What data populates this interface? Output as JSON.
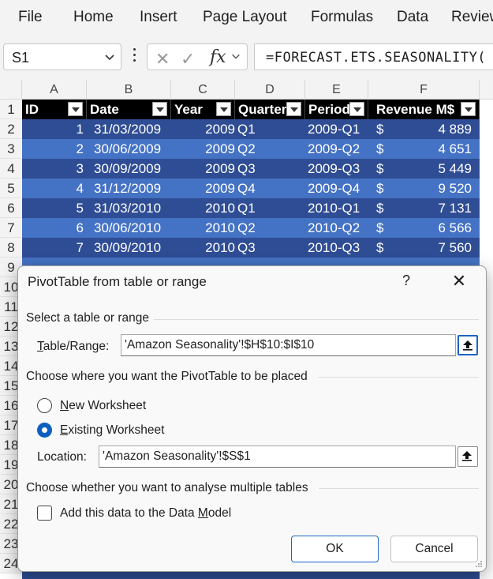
{
  "ribbon": {
    "tabs": [
      "File",
      "Home",
      "Insert",
      "Page Layout",
      "Formulas",
      "Data",
      "Review"
    ]
  },
  "formula_bar": {
    "name_box": "S1",
    "formula": "=FORECAST.ETS.SEASONALITY("
  },
  "sheet": {
    "columns": [
      "A",
      "B",
      "C",
      "D",
      "E",
      "F"
    ],
    "rows": [
      "1",
      "2",
      "3",
      "4",
      "5",
      "6",
      "7",
      "8",
      "9",
      "10",
      "11",
      "12",
      "13",
      "14",
      "15",
      "16",
      "17",
      "18",
      "19",
      "20",
      "21",
      "22",
      "23",
      "24"
    ],
    "headers": [
      "ID",
      "Date",
      "Year",
      "Quarter",
      "Period",
      "Revenue M$"
    ],
    "data": [
      {
        "id": "1",
        "date": "31/03/2009",
        "year": "2009",
        "quarter": "Q1",
        "period": "2009-Q1",
        "cur": "$",
        "revenue": "4 889"
      },
      {
        "id": "2",
        "date": "30/06/2009",
        "year": "2009",
        "quarter": "Q2",
        "period": "2009-Q2",
        "cur": "$",
        "revenue": "4 651"
      },
      {
        "id": "3",
        "date": "30/09/2009",
        "year": "2009",
        "quarter": "Q3",
        "period": "2009-Q3",
        "cur": "$",
        "revenue": "5 449"
      },
      {
        "id": "4",
        "date": "31/12/2009",
        "year": "2009",
        "quarter": "Q4",
        "period": "2009-Q4",
        "cur": "$",
        "revenue": "9 520"
      },
      {
        "id": "5",
        "date": "31/03/2010",
        "year": "2010",
        "quarter": "Q1",
        "period": "2010-Q1",
        "cur": "$",
        "revenue": "7 131"
      },
      {
        "id": "6",
        "date": "30/06/2010",
        "year": "2010",
        "quarter": "Q2",
        "period": "2010-Q2",
        "cur": "$",
        "revenue": "6 566"
      },
      {
        "id": "7",
        "date": "30/09/2010",
        "year": "2010",
        "quarter": "Q3",
        "period": "2010-Q3",
        "cur": "$",
        "revenue": "7 560"
      }
    ],
    "colors": {
      "band_dark": "#2f4d94",
      "band_light": "#4472c4",
      "header_bg": "#000000"
    }
  },
  "dialog": {
    "title": "PivotTable from table or range",
    "help": "?",
    "section_select": "Select a table or range",
    "table_range_label": "Table/Range:",
    "table_range_value": "'Amazon Seasonality'!$H$10:$I$10",
    "section_place": "Choose where you want the PivotTable to be placed",
    "option_new": "New Worksheet",
    "option_existing": "Existing Worksheet",
    "selected_option": "existing",
    "location_label": "Location:",
    "location_value": "'Amazon Seasonality'!$S$1",
    "section_multiple": "Choose whether you want to analyse multiple tables",
    "data_model_label": "Add this data to the Data Model",
    "data_model_checked": false,
    "ok": "OK",
    "cancel": "Cancel",
    "accent_color": "#0f5fc0"
  }
}
